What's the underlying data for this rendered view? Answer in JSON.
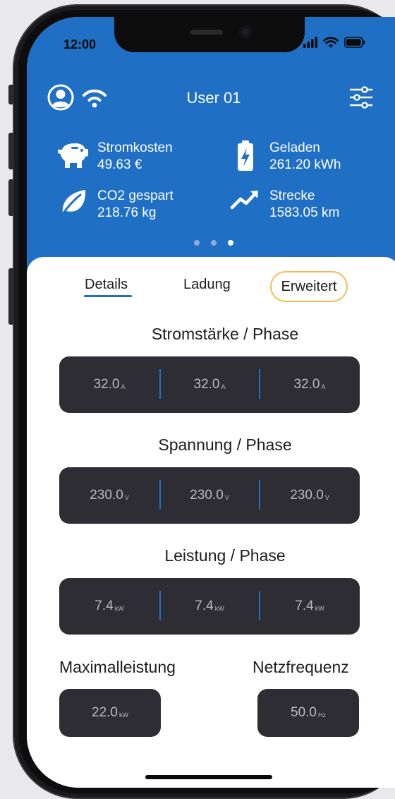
{
  "status": {
    "time": "12:00"
  },
  "header": {
    "title": "User 01"
  },
  "stats": [
    {
      "icon": "piggy-bank-icon",
      "label": "Stromkosten",
      "value": "49.63  €"
    },
    {
      "icon": "battery-charging-icon",
      "label": "Geladen",
      "value": "261.20  kWh"
    },
    {
      "icon": "leaf-icon",
      "label": "CO2 gespart",
      "value": "218.76  kg"
    },
    {
      "icon": "trend-up-icon",
      "label": "Strecke",
      "value": "1583.05  km"
    }
  ],
  "pager": {
    "count": 3,
    "active_index": 2
  },
  "tabs": [
    {
      "label": "Details",
      "state": "underlined"
    },
    {
      "label": "Ladung",
      "state": "normal"
    },
    {
      "label": "Erweitert",
      "state": "selected"
    }
  ],
  "sections": [
    {
      "title": "Stromstärke / Phase",
      "values": [
        {
          "num": "32.0",
          "unit": "A"
        },
        {
          "num": "32.0",
          "unit": "A"
        },
        {
          "num": "32.0",
          "unit": "A"
        }
      ]
    },
    {
      "title": "Spannung / Phase",
      "values": [
        {
          "num": "230.0",
          "unit": "V"
        },
        {
          "num": "230.0",
          "unit": "V"
        },
        {
          "num": "230.0",
          "unit": "V"
        }
      ]
    },
    {
      "title": "Leistung / Phase",
      "values": [
        {
          "num": "7.4",
          "unit": "kW"
        },
        {
          "num": "7.4",
          "unit": "kW"
        },
        {
          "num": "7.4",
          "unit": "kW"
        }
      ]
    }
  ],
  "max_power": {
    "title": "Maximalleistung",
    "num": "22.0",
    "unit": "kW"
  },
  "frequency": {
    "title": "Netzfrequenz",
    "num": "50.0",
    "unit": "Hz"
  },
  "colors": {
    "header_blue": "#1f6fc5",
    "panel_dark": "#2e2d33",
    "selected_tab_border": "#f4bc57"
  }
}
